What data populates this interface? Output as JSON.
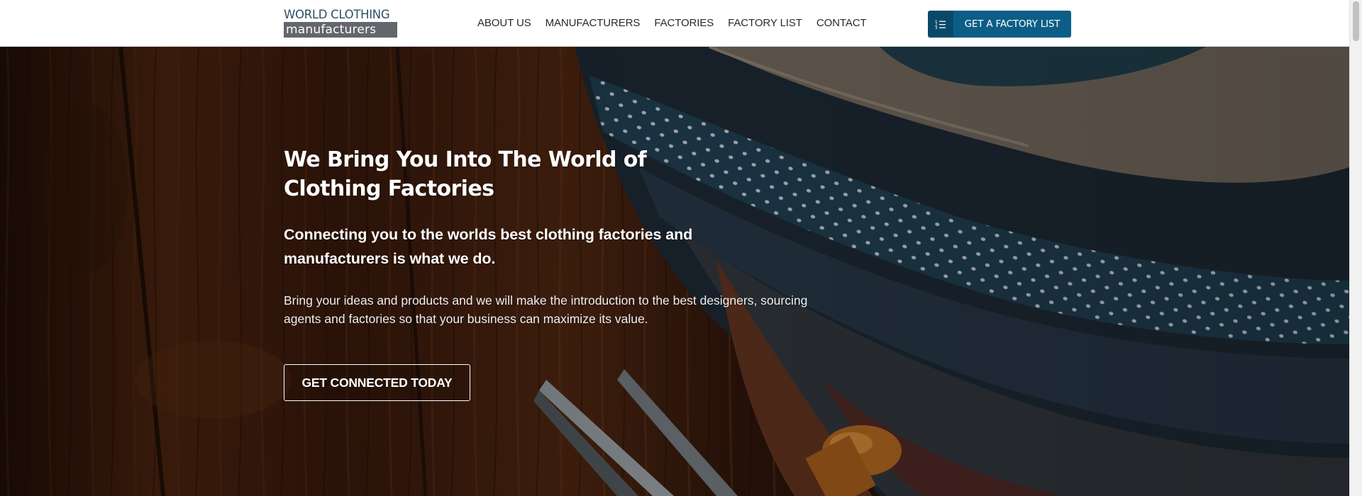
{
  "header": {
    "logo": {
      "line1": "WORLD CLOTHING",
      "line2": "manufacturers"
    },
    "nav": [
      "ABOUT US",
      "MANUFACTURERS",
      "FACTORIES",
      "FACTORY LIST",
      "CONTACT"
    ],
    "cta": {
      "label": "GET A FACTORY LIST",
      "icon": "list-icon"
    }
  },
  "hero": {
    "title": "We Bring You Into The World of Clothing Factories",
    "subtitle": "Connecting you to the worlds best clothing factories and manufacturers is what we do.",
    "body": "Bring your ideas and products and we will make the introduction to the best designers, sourcing agents and factories so that your business can maximize its value.",
    "button": "GET CONNECTED TODAY"
  },
  "colors": {
    "brand_blue": "#0c5e86",
    "logo_text": "#2c4f66",
    "logo_band": "#63666a"
  }
}
